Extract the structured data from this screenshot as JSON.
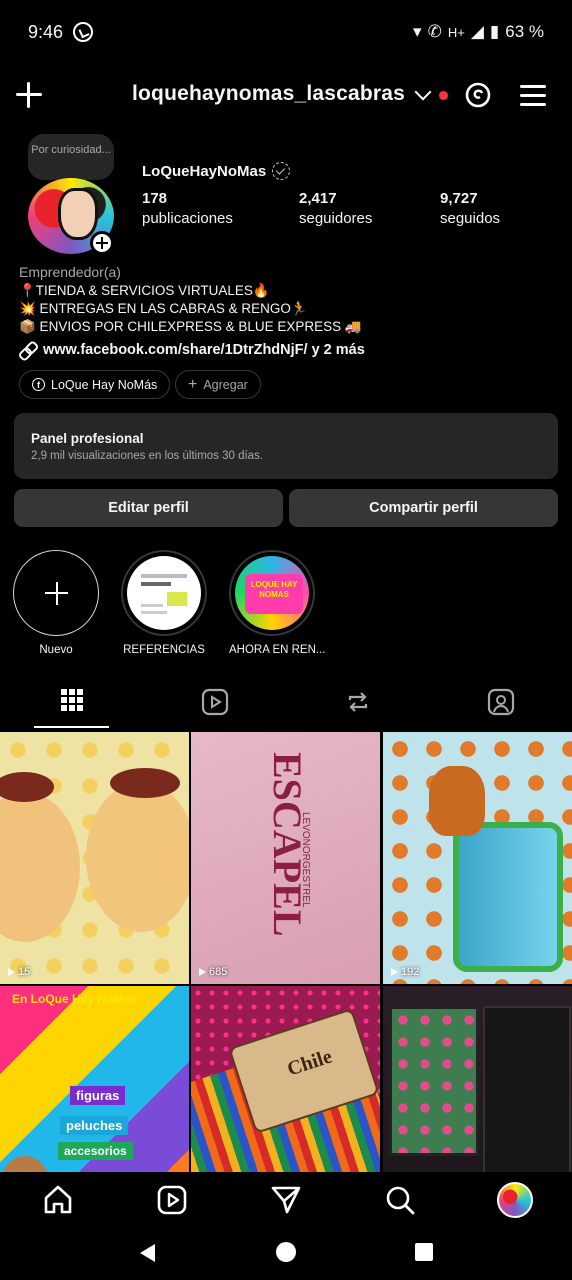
{
  "status_bar": {
    "time": "9:46",
    "network": "H+",
    "battery": "63 %"
  },
  "header": {
    "username": "loquehaynomas_lascabras"
  },
  "note": {
    "text": "Por curiosidad..."
  },
  "profile": {
    "display_name": "LoQueHayNoMas",
    "stats": [
      {
        "value": "178",
        "label": "publicaciones"
      },
      {
        "value": "2,417",
        "label": "seguidores"
      },
      {
        "value": "9,727",
        "label": "seguidos"
      }
    ],
    "category": "Emprendedor(a)",
    "bio": [
      "📍TIENDA & SERVICIOS VIRTUALES🔥",
      "💥 ENTREGAS EN LAS CABRAS & RENGO🏃",
      "📦 ENVIOS POR CHILEXPRESS & BLUE EXPRESS 🚚"
    ],
    "link_text": "www.facebook.com/share/1DtrZhdNjF/ y 2 más",
    "facebook_pill": "LoQue Hay NoMás",
    "add_pill": "Agregar"
  },
  "panel": {
    "title": "Panel profesional",
    "subtitle": "2,9 mil visualizaciones en los últimos 30 días."
  },
  "buttons": {
    "edit": "Editar perfil",
    "share": "Compartir perfil"
  },
  "highlights": [
    {
      "label": "Nuevo"
    },
    {
      "label": "REFERENCIAS"
    },
    {
      "label": "AHORA EN REN..."
    }
  ],
  "grid": [
    {
      "views": "15",
      "type": "reel"
    },
    {
      "views": "685",
      "type": "reel"
    },
    {
      "views": "192",
      "type": "reel"
    },
    {
      "views": "",
      "type": "post"
    },
    {
      "views": "",
      "type": "post"
    },
    {
      "views": "",
      "type": "post"
    }
  ],
  "grid_text": {
    "box_brand": "ESCAPEL",
    "box_sub": "LEVONORGESTREL",
    "promo_title": "En LoQue Hay NoMas",
    "promo_items": [
      "figuras",
      "peluches",
      "accesorios"
    ],
    "chile": "Chile",
    "highlight2_sign": "LOQUE HAY NOMAS"
  },
  "colors": {
    "accent_red": "#ff3040",
    "panel_bg": "#262626",
    "button_bg": "#363636"
  }
}
